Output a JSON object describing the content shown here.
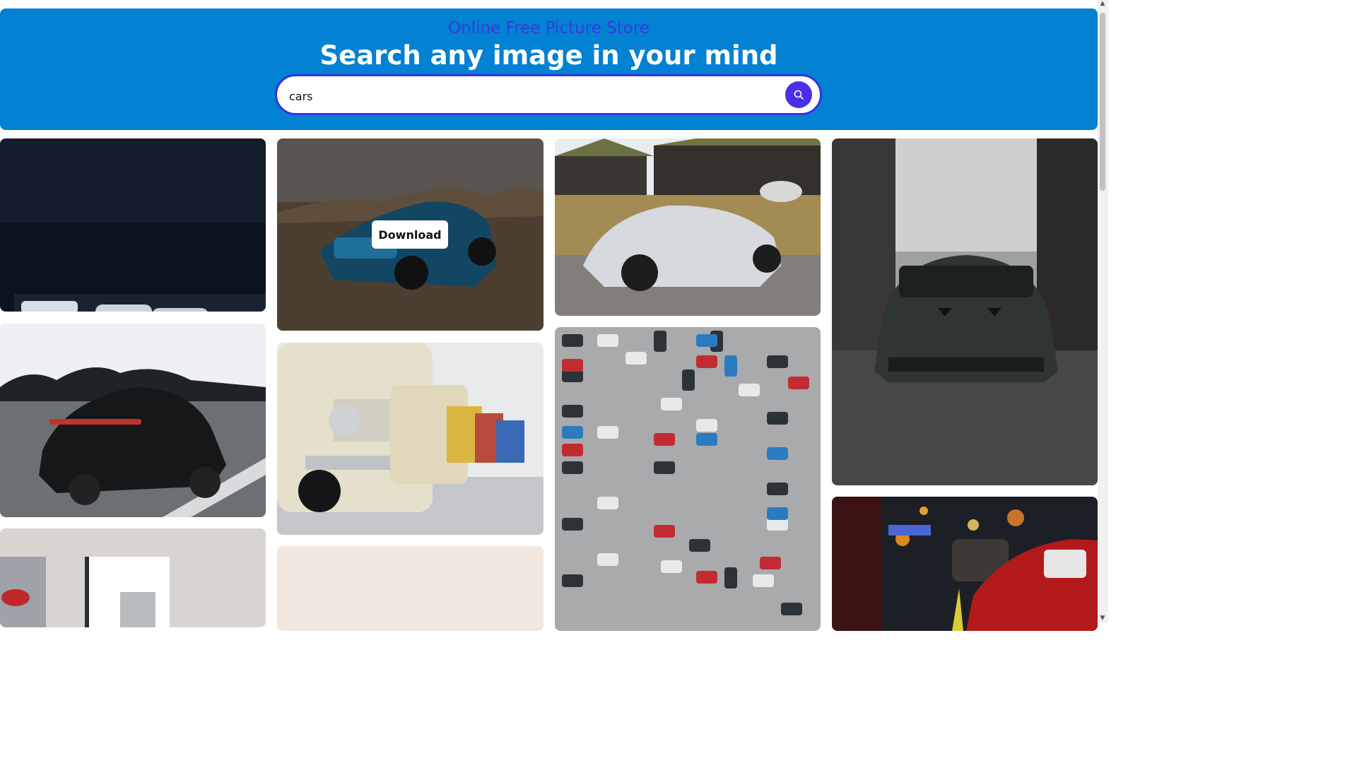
{
  "header": {
    "subtitle": "Online Free Picture Store",
    "title": "Search any image in your mind"
  },
  "search": {
    "value": "cars",
    "icon": "search-icon"
  },
  "gallery": {
    "download_label": "Download",
    "images": [
      {
        "name": "white-camaro-garage"
      },
      {
        "name": "blue-camaro-desert"
      },
      {
        "name": "mclaren-white-houses"
      },
      {
        "name": "ferrari-f40-street"
      },
      {
        "name": "black-porsche-panamera"
      },
      {
        "name": "vintage-bmw-showroom"
      },
      {
        "name": "parking-lot-aerial"
      },
      {
        "name": "red-car-night-city"
      },
      {
        "name": "interior-room-poster"
      },
      {
        "name": "beige-blank"
      }
    ]
  },
  "colors": {
    "accent": "#0381d2",
    "search_border": "#3332e6",
    "search_button": "#4b2fe8",
    "subtitle": "#3b3bd9"
  }
}
